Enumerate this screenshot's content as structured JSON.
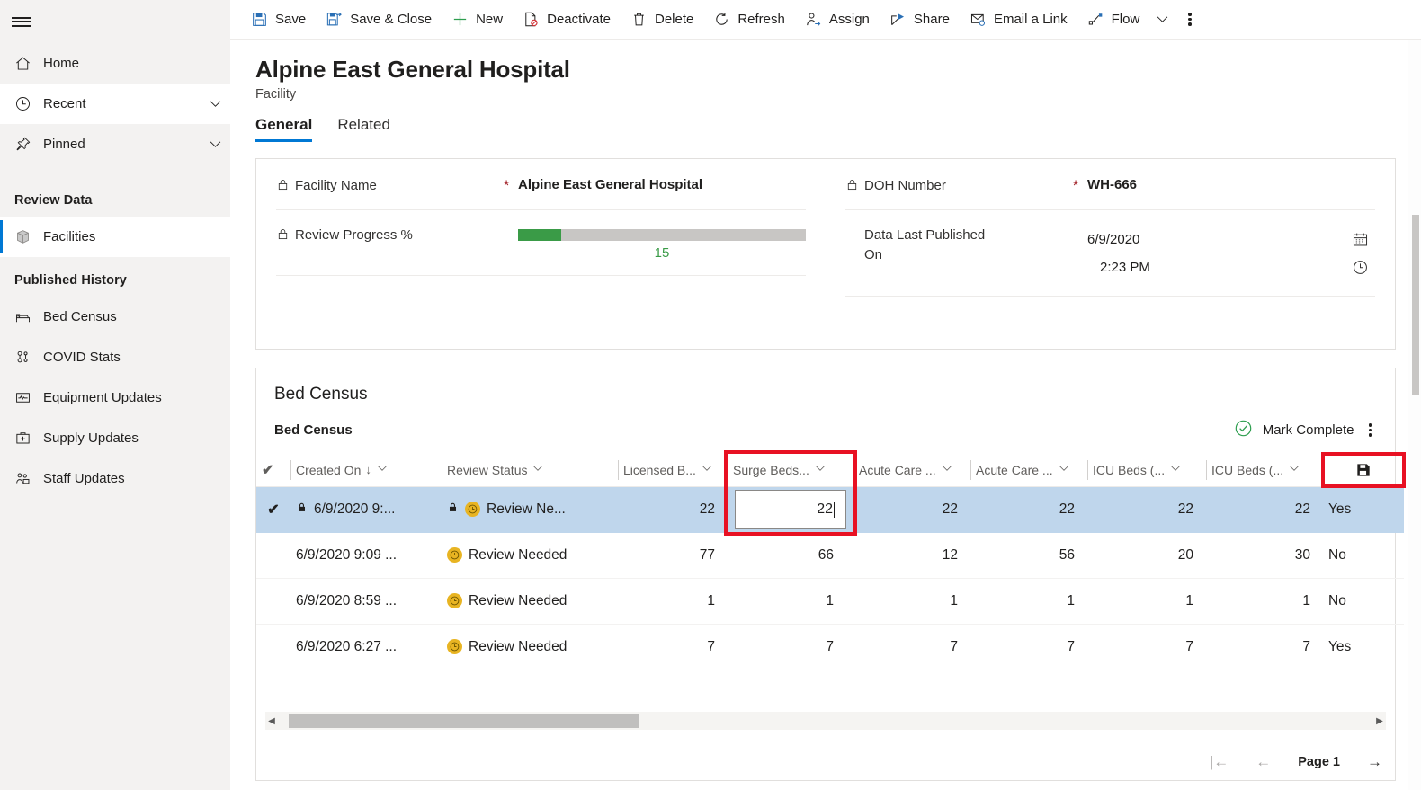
{
  "sidebar": {
    "hamburger_label": "Site map",
    "nav": [
      {
        "label": "Home",
        "icon": "home-icon",
        "chevron": false,
        "state": "plain"
      },
      {
        "label": "Recent",
        "icon": "clock-icon",
        "chevron": true,
        "state": "white"
      },
      {
        "label": "Pinned",
        "icon": "pin-icon",
        "chevron": true,
        "state": "plain"
      }
    ],
    "groups": [
      {
        "title": "Review Data",
        "items": [
          {
            "label": "Facilities",
            "icon": "cube-icon",
            "selected": true
          }
        ]
      },
      {
        "title": "Published History",
        "items": [
          {
            "label": "Bed Census",
            "icon": "bed-icon",
            "selected": false
          },
          {
            "label": "COVID Stats",
            "icon": "virus-icon",
            "selected": false
          },
          {
            "label": "Equipment Updates",
            "icon": "monitor-icon",
            "selected": false
          },
          {
            "label": "Supply Updates",
            "icon": "medkit-icon",
            "selected": false
          },
          {
            "label": "Staff Updates",
            "icon": "people-icon",
            "selected": false
          }
        ]
      }
    ]
  },
  "commandbar": {
    "items": [
      {
        "label": "Save",
        "icon": "save-icon"
      },
      {
        "label": "Save & Close",
        "icon": "save-close-icon"
      },
      {
        "label": "New",
        "icon": "plus-icon"
      },
      {
        "label": "Deactivate",
        "icon": "deactivate-icon"
      },
      {
        "label": "Delete",
        "icon": "trash-icon"
      },
      {
        "label": "Refresh",
        "icon": "refresh-icon"
      },
      {
        "label": "Assign",
        "icon": "assign-person-icon"
      },
      {
        "label": "Share",
        "icon": "share-icon"
      },
      {
        "label": "Email a Link",
        "icon": "email-link-icon"
      },
      {
        "label": "Flow",
        "icon": "flow-icon"
      }
    ],
    "overflow_label": "More commands"
  },
  "record": {
    "title": "Alpine East General Hospital",
    "subtitle": "Facility",
    "tabs": [
      {
        "label": "General",
        "active": true
      },
      {
        "label": "Related",
        "active": false
      }
    ]
  },
  "form": {
    "facility_name": {
      "label": "Facility Name",
      "required": "*",
      "value": "Alpine East General Hospital"
    },
    "review_progress": {
      "label": "Review Progress %",
      "value": 15,
      "value_text": "15",
      "bar_color": "#3a9b47",
      "track_color": "#c8c6c4"
    },
    "doh_number": {
      "label": "DOH Number",
      "required": "*",
      "value": "WH-666"
    },
    "data_last_published": {
      "label_line1": "Data Last Published",
      "label_line2": "On",
      "date": "6/9/2020",
      "time": "2:23 PM"
    }
  },
  "grid": {
    "section_title": "Bed Census",
    "subgrid_title": "Bed Census",
    "mark_complete_label": "Mark Complete",
    "columns": [
      {
        "key": "check",
        "label": "",
        "type": "check"
      },
      {
        "key": "created_on",
        "label": "Created On",
        "sort": "↓",
        "type": "text"
      },
      {
        "key": "review_status",
        "label": "Review Status",
        "type": "text"
      },
      {
        "key": "licensed_beds",
        "label": "Licensed B...",
        "type": "num"
      },
      {
        "key": "surge_beds",
        "label": "Surge Beds...",
        "type": "num",
        "highlighted": true
      },
      {
        "key": "acute_care_1",
        "label": "Acute Care ...",
        "type": "num"
      },
      {
        "key": "acute_care_2",
        "label": "Acute Care ...",
        "type": "num"
      },
      {
        "key": "icu_beds_1",
        "label": "ICU Beds (...",
        "type": "num"
      },
      {
        "key": "icu_beds_2",
        "label": "ICU Beds (...",
        "type": "num"
      },
      {
        "key": "last",
        "label": "",
        "type": "text"
      }
    ],
    "save_row_icon": "save-row-icon",
    "rows": [
      {
        "selected": true,
        "checked": "✔",
        "locked": true,
        "created_on": "6/9/2020 9:...",
        "status_locked": true,
        "review_status": "Review Ne...",
        "licensed_beds": "22",
        "surge_beds": "22",
        "surge_beds_editing": true,
        "acute_care_1": "22",
        "acute_care_2": "22",
        "icu_beds_1": "22",
        "icu_beds_2": "22",
        "last": "Yes"
      },
      {
        "selected": false,
        "checked": "",
        "locked": false,
        "created_on": "6/9/2020 9:09 ...",
        "status_locked": false,
        "review_status": "Review Needed",
        "licensed_beds": "77",
        "surge_beds": "66",
        "surge_beds_editing": false,
        "acute_care_1": "12",
        "acute_care_2": "56",
        "icu_beds_1": "20",
        "icu_beds_2": "30",
        "last": "No"
      },
      {
        "selected": false,
        "checked": "",
        "locked": false,
        "created_on": "6/9/2020 8:59 ...",
        "status_locked": false,
        "review_status": "Review Needed",
        "licensed_beds": "1",
        "surge_beds": "1",
        "surge_beds_editing": false,
        "acute_care_1": "1",
        "acute_care_2": "1",
        "icu_beds_1": "1",
        "icu_beds_2": "1",
        "last": "No"
      },
      {
        "selected": false,
        "checked": "",
        "locked": false,
        "created_on": "6/9/2020 6:27 ...",
        "status_locked": false,
        "review_status": "Review Needed",
        "licensed_beds": "7",
        "surge_beds": "7",
        "surge_beds_editing": false,
        "acute_care_1": "7",
        "acute_care_2": "7",
        "icu_beds_1": "7",
        "icu_beds_2": "7",
        "last": "Yes"
      }
    ],
    "pager": {
      "first_label": "|←",
      "prev_label": "←",
      "page_label": "Page 1",
      "next_label": "→"
    }
  },
  "colors": {
    "accent": "#0078d4",
    "selection_row": "#bfd6ec",
    "required_red": "#a4262c",
    "annotation_red": "#e81123",
    "progress_green": "#3a9b47",
    "status_amber": "#e8b422",
    "complete_green": "#2e9e4f"
  }
}
